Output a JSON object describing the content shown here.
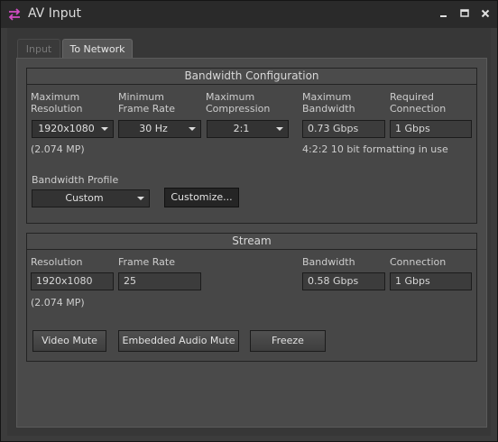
{
  "window": {
    "title": "AV Input",
    "icon": "swap-arrows-icon",
    "accent": "#d14cc4"
  },
  "tabs": [
    {
      "label": "Input",
      "active": false
    },
    {
      "label": "To Network",
      "active": true
    }
  ],
  "bandwidth_config": {
    "header": "Bandwidth Configuration",
    "max_resolution": {
      "label_line1": "Maximum",
      "label_line2": "Resolution",
      "value": "1920x1080"
    },
    "min_frame_rate": {
      "label_line1": "Minimum",
      "label_line2": "Frame Rate",
      "value": "30 Hz"
    },
    "max_compression": {
      "label_line1": "Maximum",
      "label_line2": "Compression",
      "value": "2:1"
    },
    "max_bandwidth": {
      "label_line1": "Maximum",
      "label_line2": "Bandwidth",
      "value": "0.73 Gbps"
    },
    "required_connection": {
      "label_line1": "Required",
      "label_line2": "Connection",
      "value": "1 Gbps"
    },
    "megapixels": "(2.074 MP)",
    "formatting_note": "4:2:2 10 bit formatting in use",
    "profile_label": "Bandwidth Profile",
    "profile_value": "Custom",
    "customize_label": "Customize..."
  },
  "stream": {
    "header": "Stream",
    "resolution_label": "Resolution",
    "resolution_value": "1920x1080",
    "frame_rate_label": "Frame Rate",
    "frame_rate_value": "25",
    "bandwidth_label": "Bandwidth",
    "bandwidth_value": "0.58 Gbps",
    "connection_label": "Connection",
    "connection_value": "1 Gbps",
    "megapixels": "(2.074 MP)",
    "buttons": {
      "video_mute": "Video Mute",
      "embedded_audio_mute": "Embedded Audio Mute",
      "freeze": "Freeze"
    }
  }
}
